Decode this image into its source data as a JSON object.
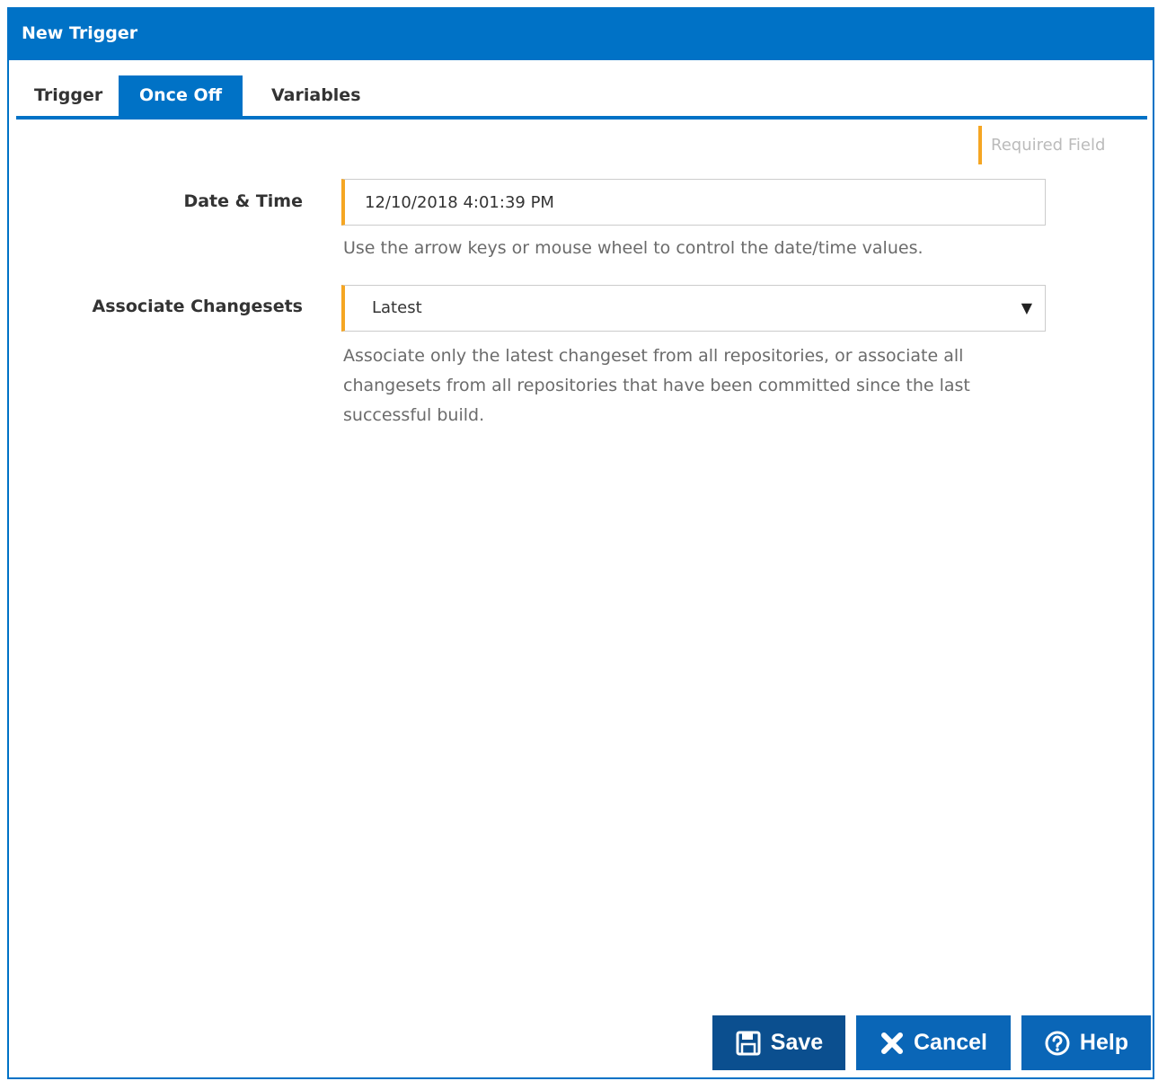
{
  "dialog": {
    "title": "New Trigger"
  },
  "tabs": [
    {
      "label": "Trigger",
      "active": false
    },
    {
      "label": "Once Off",
      "active": true
    },
    {
      "label": "Variables",
      "active": false
    }
  ],
  "legend": {
    "required_label": "Required Field",
    "required_color": "#f5a623"
  },
  "form": {
    "date_time": {
      "label": "Date & Time",
      "value": "12/10/2018 4:01:39 PM",
      "help": "Use the arrow keys or mouse wheel to control the date/time values."
    },
    "associate_changesets": {
      "label": "Associate Changesets",
      "value": "Latest",
      "help": "Associate only the latest changeset from all repositories, or associate all changesets from all repositories that have been committed since the last successful build."
    }
  },
  "buttons": {
    "save": {
      "label": "Save",
      "icon": "save-icon"
    },
    "cancel": {
      "label": "Cancel",
      "icon": "close-icon"
    },
    "help": {
      "label": "Help",
      "icon": "question-circle-icon"
    }
  },
  "colors": {
    "accent": "#0072c6",
    "button": "#0a66b7"
  }
}
